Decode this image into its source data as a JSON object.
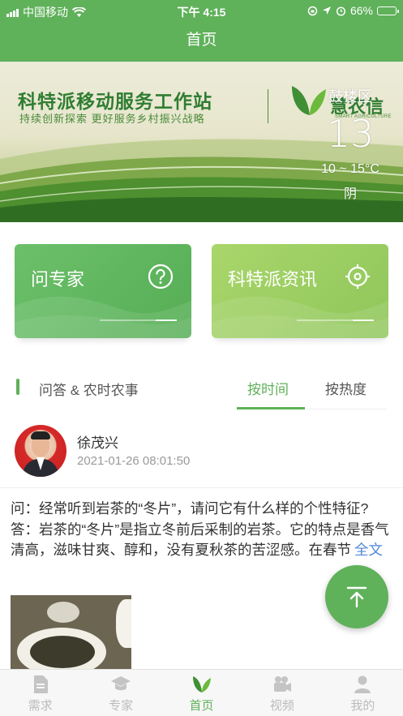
{
  "status_bar": {
    "carrier": "中国移动",
    "time": "下午 4:15",
    "battery": "66%"
  },
  "nav": {
    "title": "首页"
  },
  "banner": {
    "title": "科特派移动服务工作站",
    "subtitle": "持续创新探索 更好服务乡村振兴战略",
    "logo_text": "慧农信",
    "logo_sub": "SMART AGRICULTURE",
    "weather": {
      "district": "鼓楼区",
      "temperature": "13",
      "range": "10 ~ 15°C",
      "condition": "阴"
    }
  },
  "cards": [
    {
      "label": "问专家",
      "icon": "question-circle-icon"
    },
    {
      "label": "科特派资讯",
      "icon": "target-icon"
    }
  ],
  "section": {
    "title": "问答 & 农时农事",
    "tabs": [
      {
        "label": "按时间",
        "active": true
      },
      {
        "label": "按热度",
        "active": false
      }
    ]
  },
  "post": {
    "author": "徐茂兴",
    "time": "2021-01-26 08:01:50",
    "content": "问：经常听到岩茶的“冬片”，请问它有什么样的个性特征? 答：岩茶的“冬片”是指立冬前后采制的岩茶。它的特点是香气清高，滋味甘爽、醇和，没有夏秋茶的苦涩感。在春节",
    "more": "全文"
  },
  "tabbar": [
    {
      "label": "需求",
      "icon": "document-icon",
      "active": false
    },
    {
      "label": "专家",
      "icon": "graduation-cap-icon",
      "active": false
    },
    {
      "label": "首页",
      "icon": "leaf-icon",
      "active": true
    },
    {
      "label": "视频",
      "icon": "video-camera-icon",
      "active": false
    },
    {
      "label": "我的",
      "icon": "user-icon",
      "active": false
    }
  ],
  "colors": {
    "primary": "#5fb15a",
    "link": "#4f87d8",
    "inactive": "#bbbbbb"
  }
}
